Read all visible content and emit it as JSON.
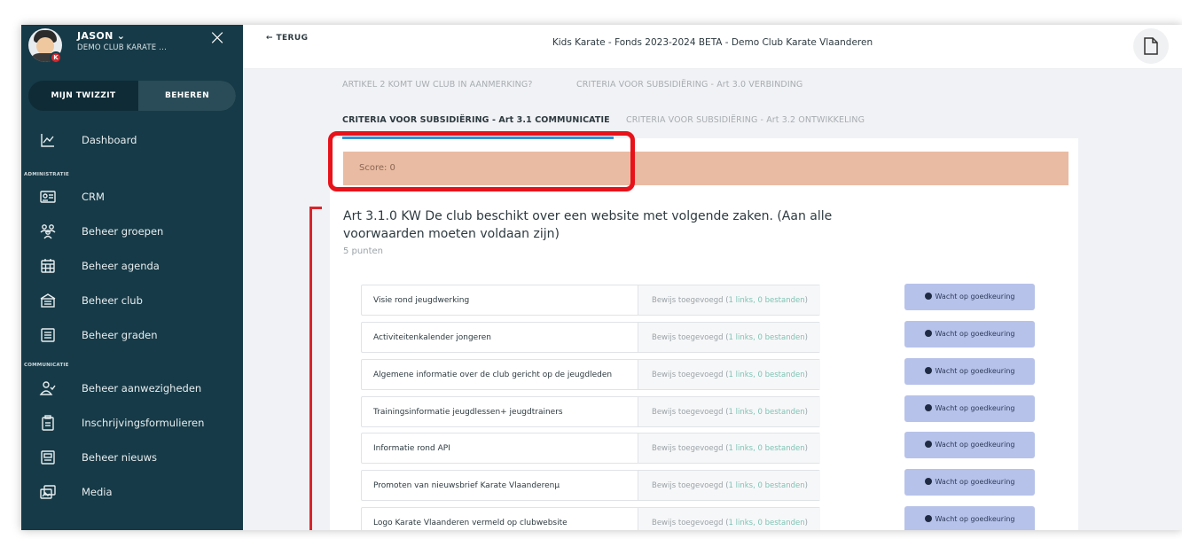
{
  "user": {
    "name": "JASON ⌄",
    "club": "DEMO CLUB KARATE ..."
  },
  "sidebar": {
    "toggle": {
      "left": "MIJN TWIZZIT",
      "right": "BEHEREN"
    },
    "section_admin": "ADMINISTRATIE",
    "section_comm": "COMMUNICATIE",
    "items": [
      {
        "label": "Dashboard",
        "icon": "chart-line-icon"
      },
      {
        "label": "CRM",
        "icon": "id-card-icon"
      },
      {
        "label": "Beheer groepen",
        "icon": "users-icon"
      },
      {
        "label": "Beheer agenda",
        "icon": "calendar-icon"
      },
      {
        "label": "Beheer club",
        "icon": "building-icon"
      },
      {
        "label": "Beheer graden",
        "icon": "list-icon"
      },
      {
        "label": "Beheer aanwezigheden",
        "icon": "user-check-icon"
      },
      {
        "label": "Inschrijvingsformulieren",
        "icon": "clipboard-icon"
      },
      {
        "label": "Beheer nieuws",
        "icon": "newspaper-icon"
      },
      {
        "label": "Media",
        "icon": "image-icon"
      }
    ]
  },
  "header": {
    "back": "← TERUG",
    "title": "Kids Karate - Fonds 2023-2024 BETA - Demo Club Karate Vlaanderen"
  },
  "tabs": [
    {
      "label": "ARTIKEL 2 KOMT UW CLUB IN AANMERKING?"
    },
    {
      "label": "CRITERIA VOOR SUBSIDIËRING - Art 3.0 VERBINDING"
    },
    {
      "label": "CRITERIA VOOR SUBSIDIËRING - Art 3.1 COMMUNICATIE"
    },
    {
      "label": "CRITERIA VOOR SUBSIDIËRING - Art 3.2 ONTWIKKELING"
    }
  ],
  "score": "Score: 0",
  "question": {
    "title": "Art 3.1.0 KW De club beschikt over een website met volgende zaken. (Aan alle voorwaarden moeten voldaan zijn)",
    "points": "5 punten"
  },
  "evidence": {
    "prefix": "Bewijs toegevoegd (",
    "links": "1 links, 0 bestanden",
    "suffix": ")"
  },
  "status_label": "Wacht op goedkeuring",
  "rows": [
    {
      "name": "Visie rond jeugdwerking"
    },
    {
      "name": "Activiteitenkalender jongeren"
    },
    {
      "name": "Algemene informatie over de club gericht op de jeugdleden"
    },
    {
      "name": "Trainingsinformatie jeugdlessen+ jeugdtrainers"
    },
    {
      "name": "Informatie rond API"
    },
    {
      "name": "Promoten van nieuwsbrief Karate Vlaanderenµ"
    },
    {
      "name": "Logo Karate Vlaanderen vermeld op clubwebsite"
    }
  ],
  "colors": {
    "sidebar": "#163a47",
    "score_bg": "#e9bba2",
    "status_pill": "#b7c2ea",
    "highlight": "#e8121a"
  }
}
